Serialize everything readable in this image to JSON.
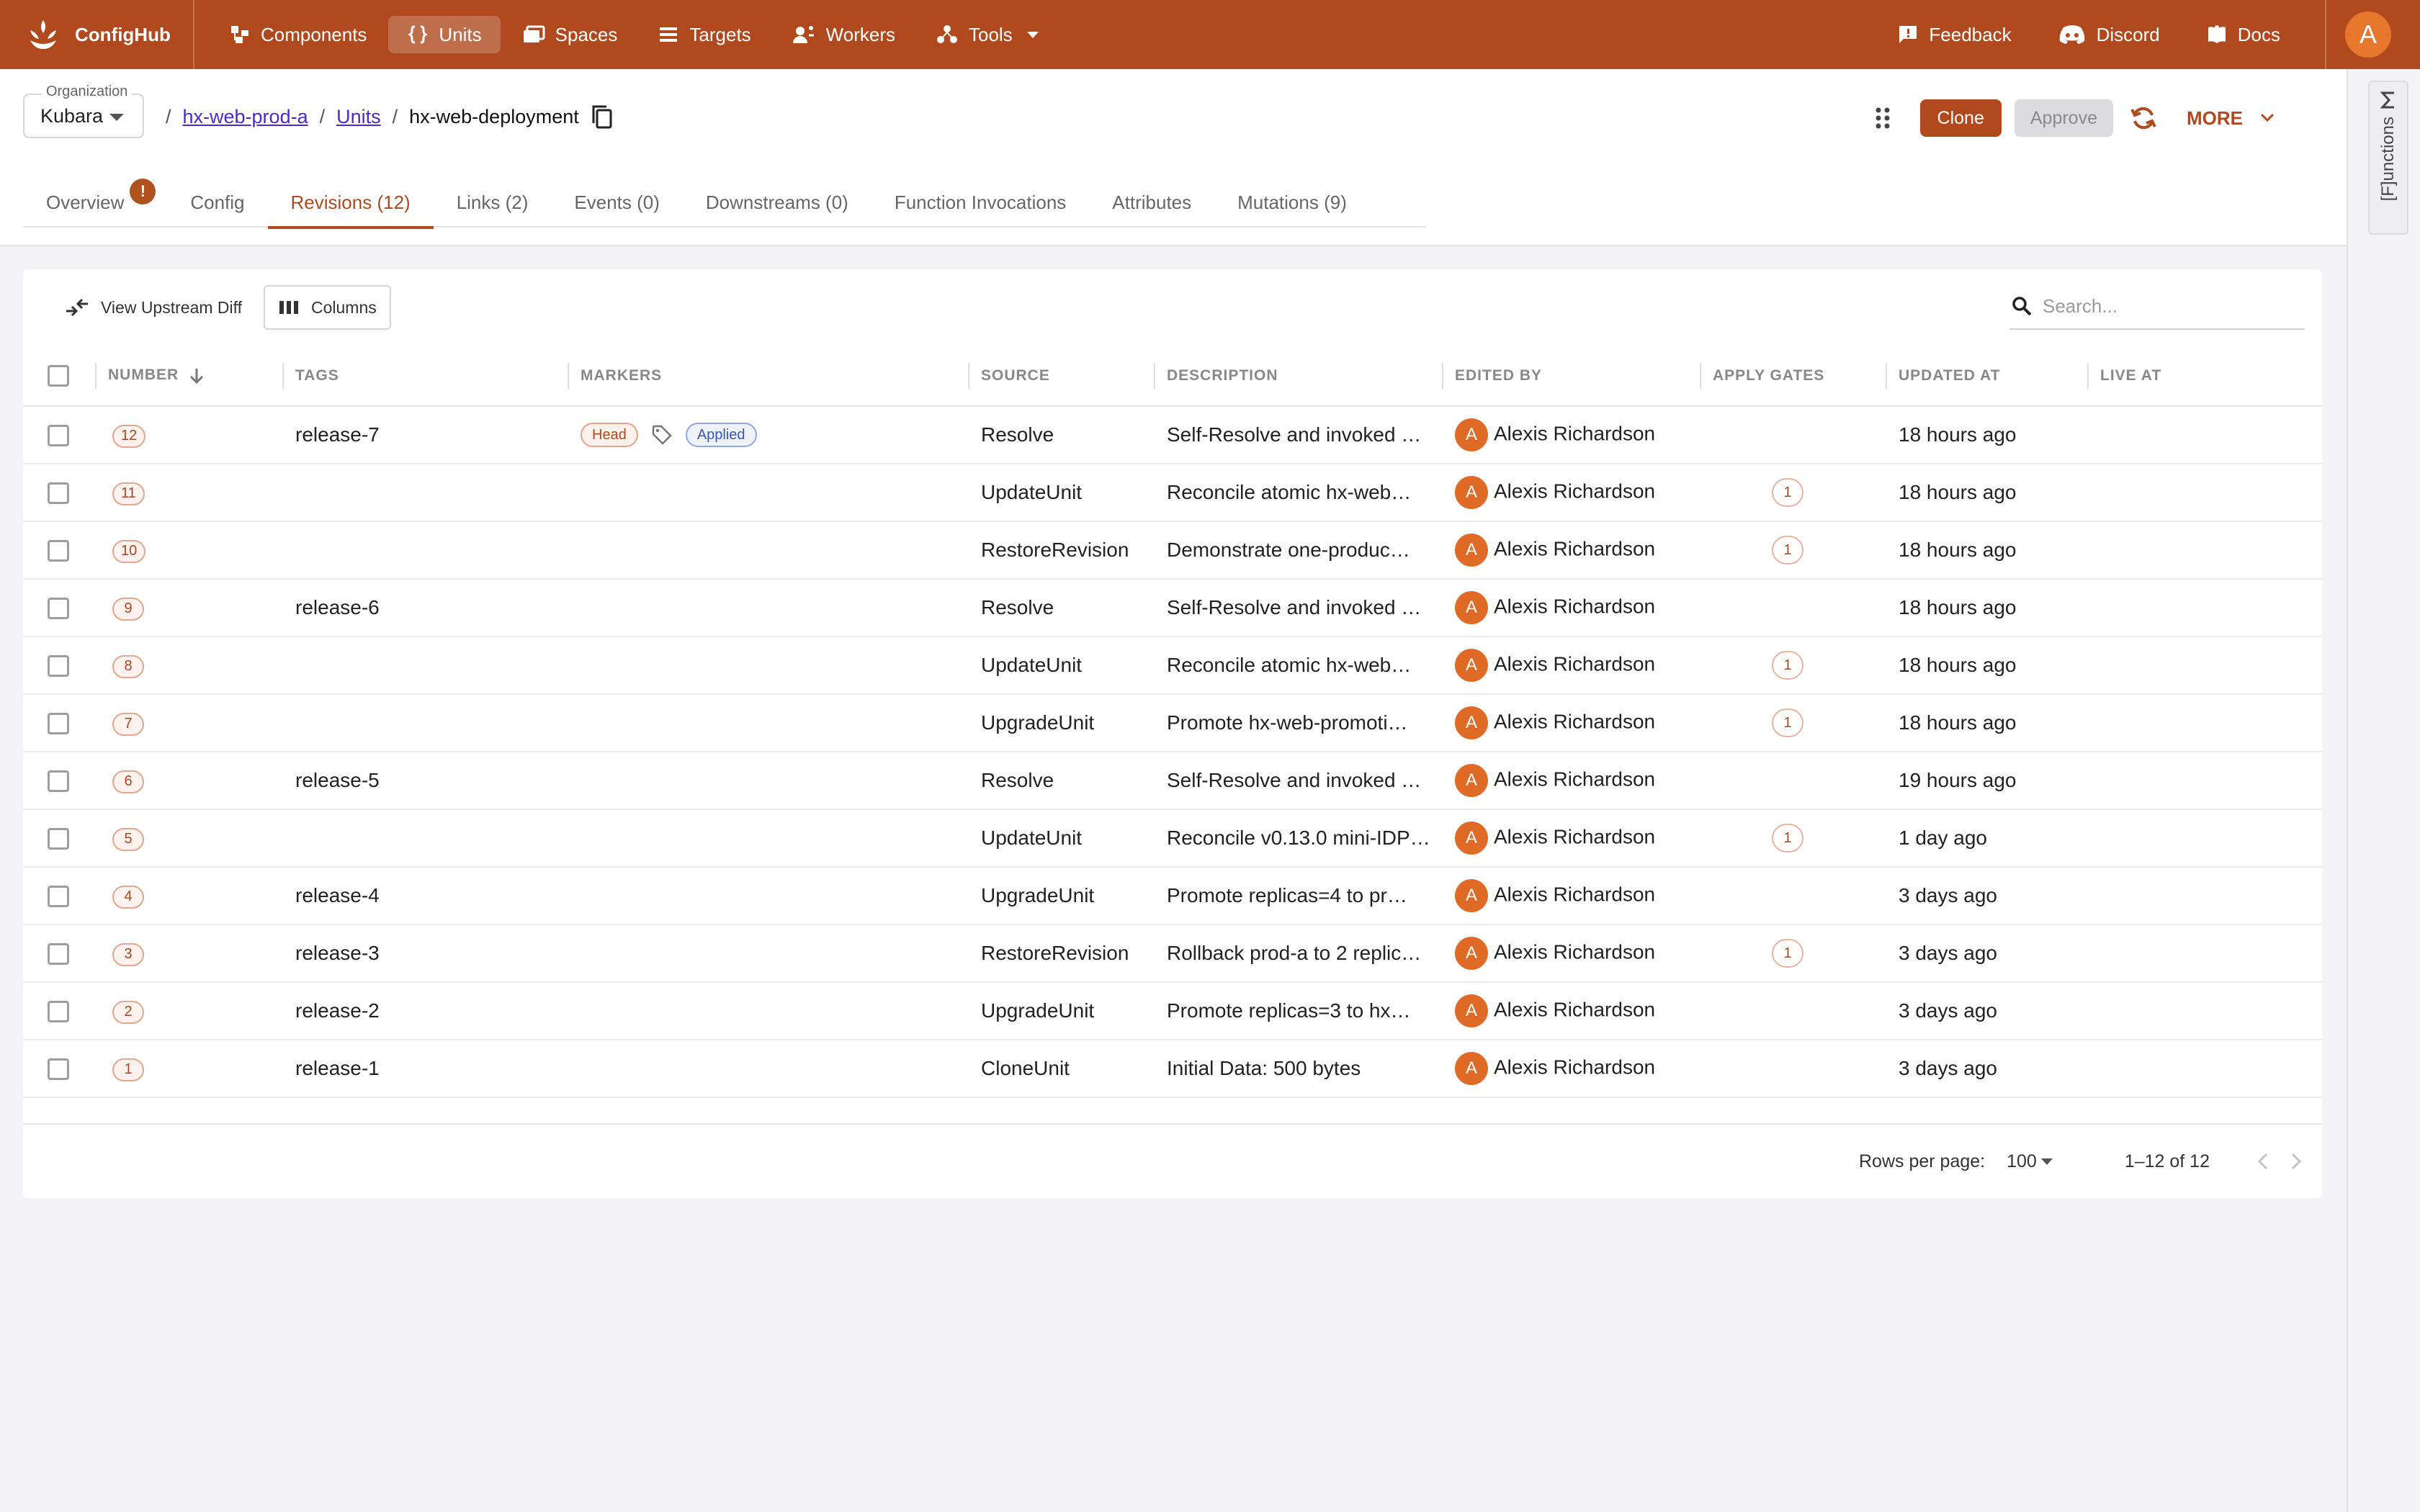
{
  "app": {
    "name": "ConfigHub"
  },
  "nav": {
    "items": [
      {
        "label": "Components",
        "icon": "components-icon"
      },
      {
        "label": "Units",
        "icon": "braces-icon"
      },
      {
        "label": "Spaces",
        "icon": "folder-icon"
      },
      {
        "label": "Targets",
        "icon": "list-icon"
      },
      {
        "label": "Workers",
        "icon": "workers-icon"
      },
      {
        "label": "Tools",
        "icon": "tools-icon"
      }
    ],
    "right": [
      {
        "label": "Feedback",
        "icon": "feedback-icon"
      },
      {
        "label": "Discord",
        "icon": "discord-icon"
      },
      {
        "label": "Docs",
        "icon": "docs-icon"
      }
    ],
    "avatar": "A"
  },
  "header": {
    "org_label": "Organization",
    "org_value": "Kubara",
    "breadcrumb": {
      "space": "hx-web-prod-a",
      "section": "Units",
      "current": "hx-web-deployment"
    },
    "actions": {
      "clone": "Clone",
      "approve": "Approve",
      "more": "MORE"
    }
  },
  "tabs": [
    {
      "label": "Overview"
    },
    {
      "label": "Config"
    },
    {
      "label": "Revisions (12)"
    },
    {
      "label": "Links (2)"
    },
    {
      "label": "Events (0)"
    },
    {
      "label": "Downstreams (0)"
    },
    {
      "label": "Function Invocations"
    },
    {
      "label": "Attributes"
    },
    {
      "label": "Mutations (9)"
    }
  ],
  "overview_alert": "!",
  "side_panel": {
    "label": "[F]unctions"
  },
  "toolbar": {
    "upstream_diff": "View Upstream Diff",
    "columns": "Columns",
    "search_placeholder": "Search..."
  },
  "table": {
    "headers": [
      "NUMBER",
      "TAGS",
      "MARKERS",
      "SOURCE",
      "DESCRIPTION",
      "EDITED BY",
      "APPLY GATES",
      "UPDATED AT",
      "LIVE AT"
    ],
    "markers": {
      "head": "Head",
      "applied": "Applied"
    },
    "rows": [
      {
        "number": "12",
        "tag": "release-7",
        "source": "Resolve",
        "description": "Self-Resolve and invoked …",
        "editor": "Alexis Richardson",
        "editor_initial": "A",
        "gates": "",
        "updated": "18 hours ago",
        "live": ""
      },
      {
        "number": "11",
        "tag": "",
        "source": "UpdateUnit",
        "description": "Reconcile atomic hx-web…",
        "editor": "Alexis Richardson",
        "editor_initial": "A",
        "gates": "1",
        "updated": "18 hours ago",
        "live": ""
      },
      {
        "number": "10",
        "tag": "",
        "source": "RestoreRevision",
        "description": "Demonstrate one-produc…",
        "editor": "Alexis Richardson",
        "editor_initial": "A",
        "gates": "1",
        "updated": "18 hours ago",
        "live": ""
      },
      {
        "number": "9",
        "tag": "release-6",
        "source": "Resolve",
        "description": "Self-Resolve and invoked …",
        "editor": "Alexis Richardson",
        "editor_initial": "A",
        "gates": "",
        "updated": "18 hours ago",
        "live": ""
      },
      {
        "number": "8",
        "tag": "",
        "source": "UpdateUnit",
        "description": "Reconcile atomic hx-web…",
        "editor": "Alexis Richardson",
        "editor_initial": "A",
        "gates": "1",
        "updated": "18 hours ago",
        "live": ""
      },
      {
        "number": "7",
        "tag": "",
        "source": "UpgradeUnit",
        "description": "Promote hx-web-promoti…",
        "editor": "Alexis Richardson",
        "editor_initial": "A",
        "gates": "1",
        "updated": "18 hours ago",
        "live": ""
      },
      {
        "number": "6",
        "tag": "release-5",
        "source": "Resolve",
        "description": "Self-Resolve and invoked …",
        "editor": "Alexis Richardson",
        "editor_initial": "A",
        "gates": "",
        "updated": "19 hours ago",
        "live": ""
      },
      {
        "number": "5",
        "tag": "",
        "source": "UpdateUnit",
        "description": "Reconcile v0.13.0 mini-IDP…",
        "editor": "Alexis Richardson",
        "editor_initial": "A",
        "gates": "1",
        "updated": "1 day ago",
        "live": ""
      },
      {
        "number": "4",
        "tag": "release-4",
        "source": "UpgradeUnit",
        "description": "Promote replicas=4 to pr…",
        "editor": "Alexis Richardson",
        "editor_initial": "A",
        "gates": "",
        "updated": "3 days ago",
        "live": ""
      },
      {
        "number": "3",
        "tag": "release-3",
        "source": "RestoreRevision",
        "description": "Rollback prod-a to 2 replic…",
        "editor": "Alexis Richardson",
        "editor_initial": "A",
        "gates": "1",
        "updated": "3 days ago",
        "live": ""
      },
      {
        "number": "2",
        "tag": "release-2",
        "source": "UpgradeUnit",
        "description": "Promote replicas=3 to hx…",
        "editor": "Alexis Richardson",
        "editor_initial": "A",
        "gates": "",
        "updated": "3 days ago",
        "live": ""
      },
      {
        "number": "1",
        "tag": "release-1",
        "source": "CloneUnit",
        "description": "Initial Data: 500 bytes",
        "editor": "Alexis Richardson",
        "editor_initial": "A",
        "gates": "",
        "updated": "3 days ago",
        "live": ""
      }
    ]
  },
  "footer": {
    "rows_per_page_label": "Rows per page:",
    "rows_per_page": "100",
    "range": "1–12 of 12"
  },
  "colors": {
    "brand": "#b04a1e",
    "avatar": "#df6a26",
    "link": "#4a2ad0"
  }
}
